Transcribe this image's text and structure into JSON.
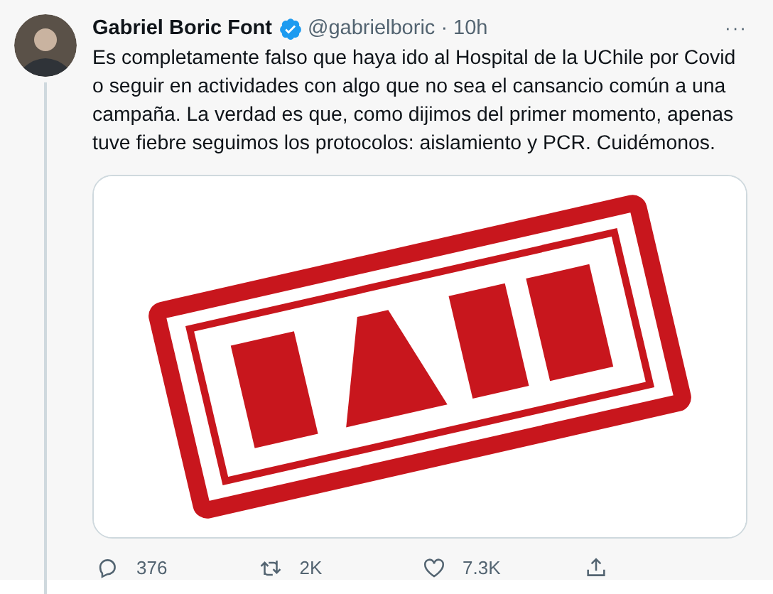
{
  "tweet": {
    "author": "Gabriel Boric Font",
    "verified": true,
    "handle": "@gabrielboric",
    "separator": "·",
    "time": "10h",
    "more": "···",
    "text": "Es completamente falso que haya ido al Hospital de la UChile por Covid o seguir en actividades con algo que no sea el cansancio común a una campaña. La verdad es que, como dijimos del primer momento, apenas tuve fiebre seguimos los protocolos: aislamiento y PCR. Cuidémonos.",
    "actions": [
      {
        "kind": "reply",
        "count": "376"
      },
      {
        "kind": "retweet",
        "count": "2K"
      },
      {
        "kind": "like",
        "count": "7.3K"
      },
      {
        "kind": "share"
      }
    ]
  }
}
